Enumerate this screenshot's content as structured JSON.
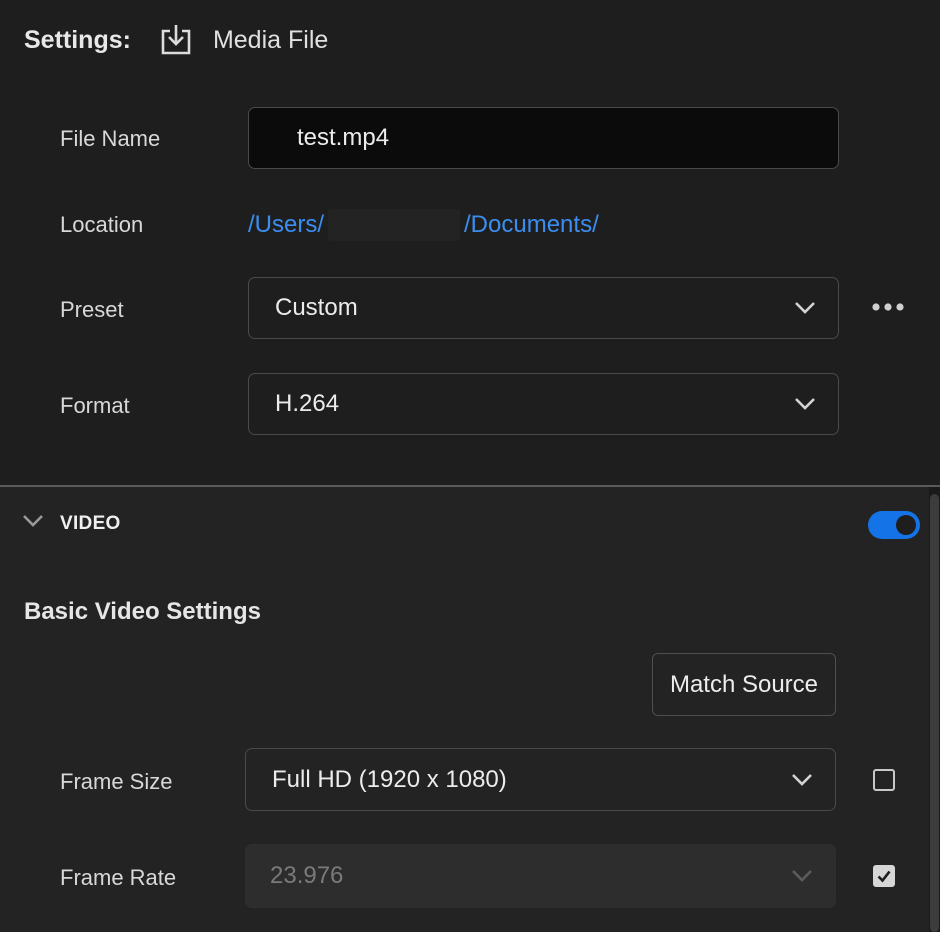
{
  "header": {
    "settings_label": "Settings:",
    "output_type": "Media File"
  },
  "file_name": {
    "label": "File Name",
    "value": "test.mp4"
  },
  "location": {
    "label": "Location",
    "path_prefix": "/Users/",
    "path_suffix": "/Documents/"
  },
  "preset": {
    "label": "Preset",
    "value": "Custom"
  },
  "format": {
    "label": "Format",
    "value": "H.264"
  },
  "video": {
    "section_title": "VIDEO",
    "enabled": true,
    "basic_settings_title": "Basic Video Settings",
    "match_source_label": "Match Source",
    "frame_size": {
      "label": "Frame Size",
      "value": "Full HD (1920 x 1080)",
      "checked": false
    },
    "frame_rate": {
      "label": "Frame Rate",
      "value": "23.976",
      "checked": true
    }
  },
  "colors": {
    "accent": "#1473e6",
    "link": "#3b8ef0",
    "background": "#1e1e1e",
    "section_background": "#232323"
  },
  "icons": {
    "output": "download-icon",
    "dropdown": "chevron-down-icon",
    "more": "more-horizontal-icon"
  }
}
